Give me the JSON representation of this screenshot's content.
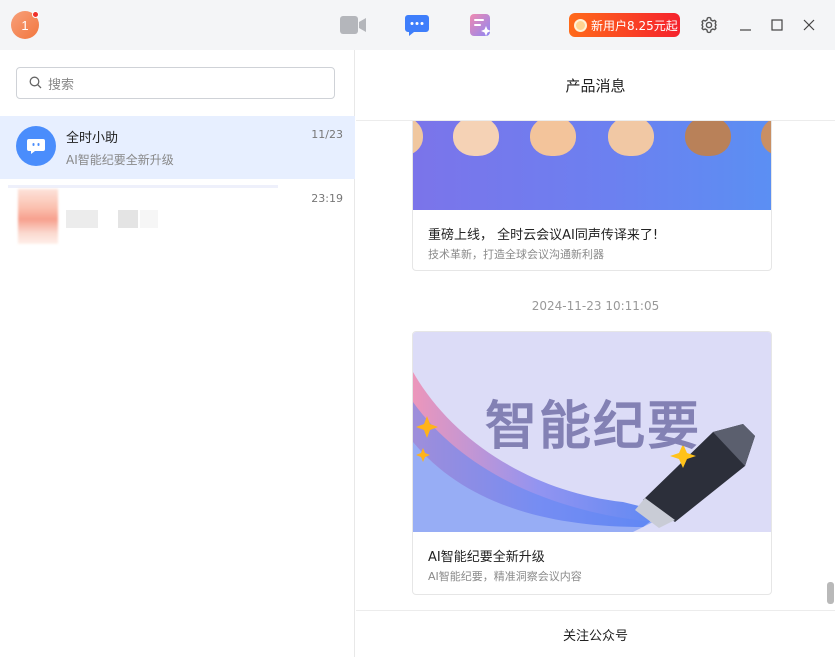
{
  "titlebar": {
    "avatar_label": "1",
    "nav_icons": [
      "video-meeting-icon",
      "chat-icon",
      "notes-icon"
    ],
    "promo_label": "新用户8.25元起",
    "window_icons": [
      "gear-icon",
      "minimize-icon",
      "maximize-icon",
      "close-icon"
    ]
  },
  "sidebar": {
    "search": {
      "placeholder": "搜索"
    },
    "conversations": [
      {
        "name": "全时小助",
        "preview": "AI智能纪要全新升级",
        "time": "11/23",
        "active": true
      },
      {
        "name": "",
        "preview": "",
        "time": "23:19",
        "active": false
      }
    ]
  },
  "main": {
    "header_title": "产品消息",
    "feed": {
      "cards": [
        {
          "title": "重磅上线， 全时云会议AI同声传译来了!",
          "subtitle": "技术革新，打造全球会议沟通新利器"
        },
        {
          "banner_text": "智能纪要",
          "title": "AI智能纪要全新升级",
          "subtitle": "AI智能纪要，精准洞察会议内容"
        }
      ],
      "timestamp": "2024-11-23 10:11:05"
    },
    "footer_label": "关注公众号"
  },
  "colors": {
    "accent": "#4a8dfc",
    "active_row": "#e7efff",
    "promo_start": "#ff6a1a",
    "promo_end": "#f5222d",
    "banner_blue": "#6c80f0",
    "badge_red": "#f0302a"
  }
}
